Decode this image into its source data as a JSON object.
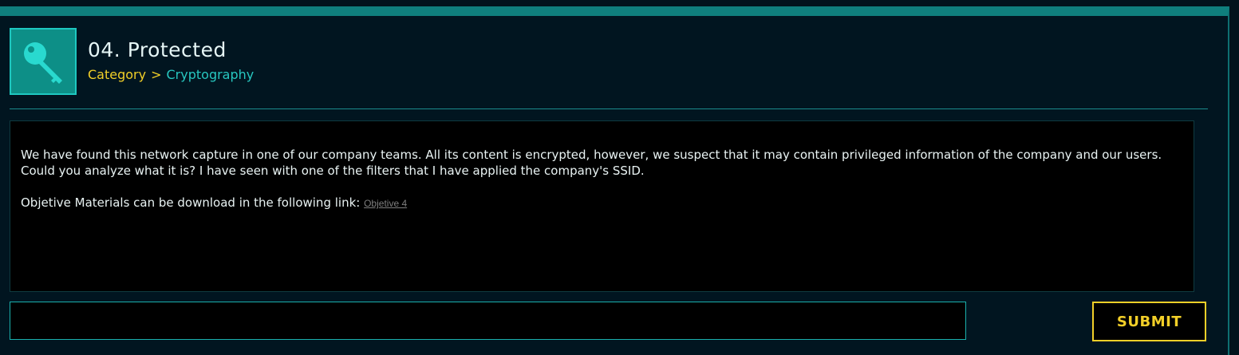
{
  "challenge": {
    "title": "04. Protected",
    "icon": "key-icon",
    "breadcrumb": {
      "category_label": "Category",
      "separator": ">",
      "current": "Cryptography"
    },
    "description": {
      "paragraph1": "We have found this network capture in one of our company teams. All its content is encrypted, however, we suspect that it may contain privileged information of the company and our users. Could you analyze what it is? I have seen with one of the filters that I have applied the company's SSID.",
      "materials_prefix": "Objetive Materials can be download in the following link:",
      "materials_link_text": "Objetive 4"
    }
  },
  "answer": {
    "value": "",
    "placeholder": ""
  },
  "submit_label": "SUBMIT",
  "colors": {
    "accent_teal": "#1ab0ac",
    "accent_yellow": "#f2cf28",
    "background": "#011520"
  }
}
